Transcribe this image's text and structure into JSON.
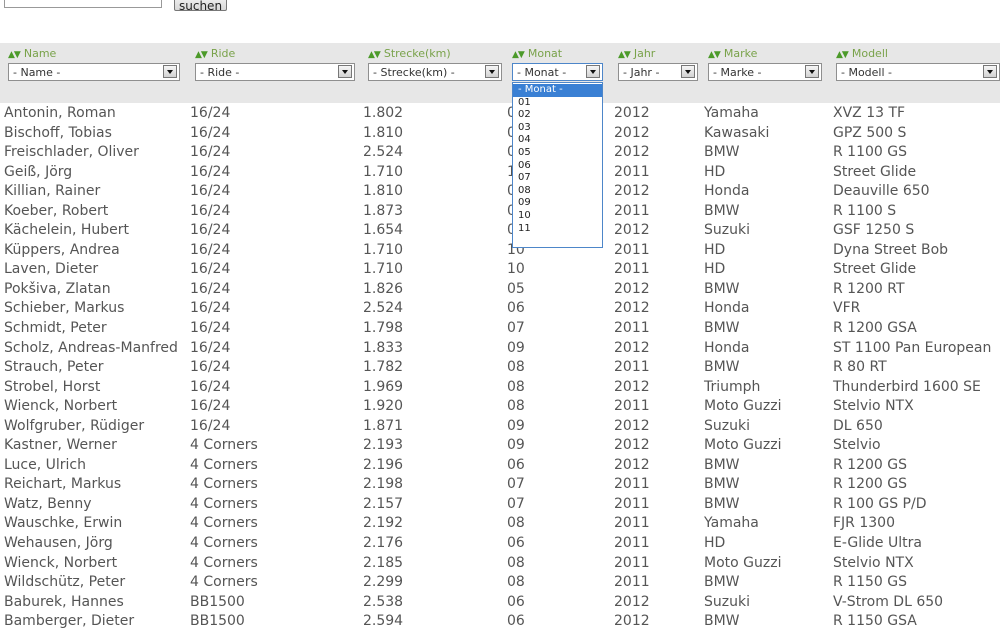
{
  "search": {
    "value": "",
    "button_label": "suchen"
  },
  "columns": [
    {
      "key": "name",
      "label": "Name",
      "select_value": "- Name -"
    },
    {
      "key": "ride",
      "label": "Ride",
      "select_value": "- Ride -"
    },
    {
      "key": "strecke",
      "label": "Strecke(km)",
      "select_value": "- Strecke(km) -"
    },
    {
      "key": "monat",
      "label": "Monat",
      "select_value": "- Monat -"
    },
    {
      "key": "jahr",
      "label": "Jahr",
      "select_value": "- Jahr -"
    },
    {
      "key": "marke",
      "label": "Marke",
      "select_value": "- Marke -"
    },
    {
      "key": "modell",
      "label": "Modell",
      "select_value": "- Modell -"
    }
  ],
  "sort_arrows": "▲▼",
  "monat_dropdown": {
    "open": true,
    "options": [
      "- Monat -",
      "01",
      "02",
      "03",
      "04",
      "05",
      "06",
      "07",
      "08",
      "09",
      "10",
      "11"
    ],
    "selected_index": 0
  },
  "rows": [
    [
      "Antonin, Roman",
      "16/24",
      "1.802",
      "0",
      "2012",
      "Yamaha",
      "XVZ 13 TF"
    ],
    [
      "Bischoff, Tobias",
      "16/24",
      "1.810",
      "0",
      "2012",
      "Kawasaki",
      "GPZ 500 S"
    ],
    [
      "Freischlader, Oliver",
      "16/24",
      "2.524",
      "0",
      "2012",
      "BMW",
      "R 1100 GS"
    ],
    [
      "Geiß, Jörg",
      "16/24",
      "1.710",
      "1",
      "2011",
      "HD",
      "Street Glide"
    ],
    [
      "Killian, Rainer",
      "16/24",
      "1.810",
      "0",
      "2012",
      "Honda",
      "Deauville 650"
    ],
    [
      "Koeber, Robert",
      "16/24",
      "1.873",
      "0",
      "2011",
      "BMW",
      "R 1100 S"
    ],
    [
      "Kächelein, Hubert",
      "16/24",
      "1.654",
      "0",
      "2012",
      "Suzuki",
      "GSF 1250 S"
    ],
    [
      "Küppers, Andrea",
      "16/24",
      "1.710",
      "10",
      "2011",
      "HD",
      "Dyna Street Bob"
    ],
    [
      "Laven, Dieter",
      "16/24",
      "1.710",
      "10",
      "2011",
      "HD",
      "Street Glide"
    ],
    [
      "Pokšiva, Zlatan",
      "16/24",
      "1.826",
      "05",
      "2012",
      "BMW",
      "R 1200 RT"
    ],
    [
      "Schieber, Markus",
      "16/24",
      "2.524",
      "06",
      "2012",
      "Honda",
      "VFR"
    ],
    [
      "Schmidt, Peter",
      "16/24",
      "1.798",
      "07",
      "2011",
      "BMW",
      "R 1200 GSA"
    ],
    [
      "Scholz, Andreas-Manfred",
      "16/24",
      "1.833",
      "09",
      "2012",
      "Honda",
      "ST 1100 Pan European"
    ],
    [
      "Strauch, Peter",
      "16/24",
      "1.782",
      "08",
      "2011",
      "BMW",
      "R 80 RT"
    ],
    [
      "Strobel, Horst",
      "16/24",
      "1.969",
      "08",
      "2012",
      "Triumph",
      "Thunderbird 1600 SE"
    ],
    [
      "Wienck, Norbert",
      "16/24",
      "1.920",
      "08",
      "2011",
      "Moto Guzzi",
      "Stelvio NTX"
    ],
    [
      "Wolfgruber, Rüdiger",
      "16/24",
      "1.871",
      "09",
      "2012",
      "Suzuki",
      "DL 650"
    ],
    [
      "Kastner, Werner",
      "4 Corners",
      "2.193",
      "09",
      "2012",
      "Moto Guzzi",
      "Stelvio"
    ],
    [
      "Luce, Ulrich",
      "4 Corners",
      "2.196",
      "06",
      "2012",
      "BMW",
      "R 1200 GS"
    ],
    [
      "Reichart, Markus",
      "4 Corners",
      "2.198",
      "07",
      "2011",
      "BMW",
      "R 1200 GS"
    ],
    [
      "Watz, Benny",
      "4 Corners",
      "2.157",
      "07",
      "2011",
      "BMW",
      "R 100 GS P/D"
    ],
    [
      "Wauschke, Erwin",
      "4 Corners",
      "2.192",
      "08",
      "2011",
      "Yamaha",
      "FJR 1300"
    ],
    [
      "Wehausen, Jörg",
      "4 Corners",
      "2.176",
      "06",
      "2011",
      "HD",
      "E-Glide Ultra"
    ],
    [
      "Wienck, Norbert",
      "4 Corners",
      "2.185",
      "08",
      "2011",
      "Moto Guzzi",
      "Stelvio NTX"
    ],
    [
      "Wildschütz, Peter",
      "4 Corners",
      "2.299",
      "08",
      "2011",
      "BMW",
      "R 1150 GS"
    ],
    [
      "Baburek, Hannes",
      "BB1500",
      "2.538",
      "06",
      "2012",
      "Suzuki",
      "V-Strom DL 650"
    ],
    [
      "Bamberger, Dieter",
      "BB1500",
      "2.594",
      "06",
      "2012",
      "BMW",
      "R 1150 GSA"
    ]
  ],
  "colors": {
    "header_green": "#79a24a",
    "arrow_green": "#4c9a2a",
    "filter_band": "#e7e7e7",
    "dropdown_highlight": "#3a80d4"
  }
}
